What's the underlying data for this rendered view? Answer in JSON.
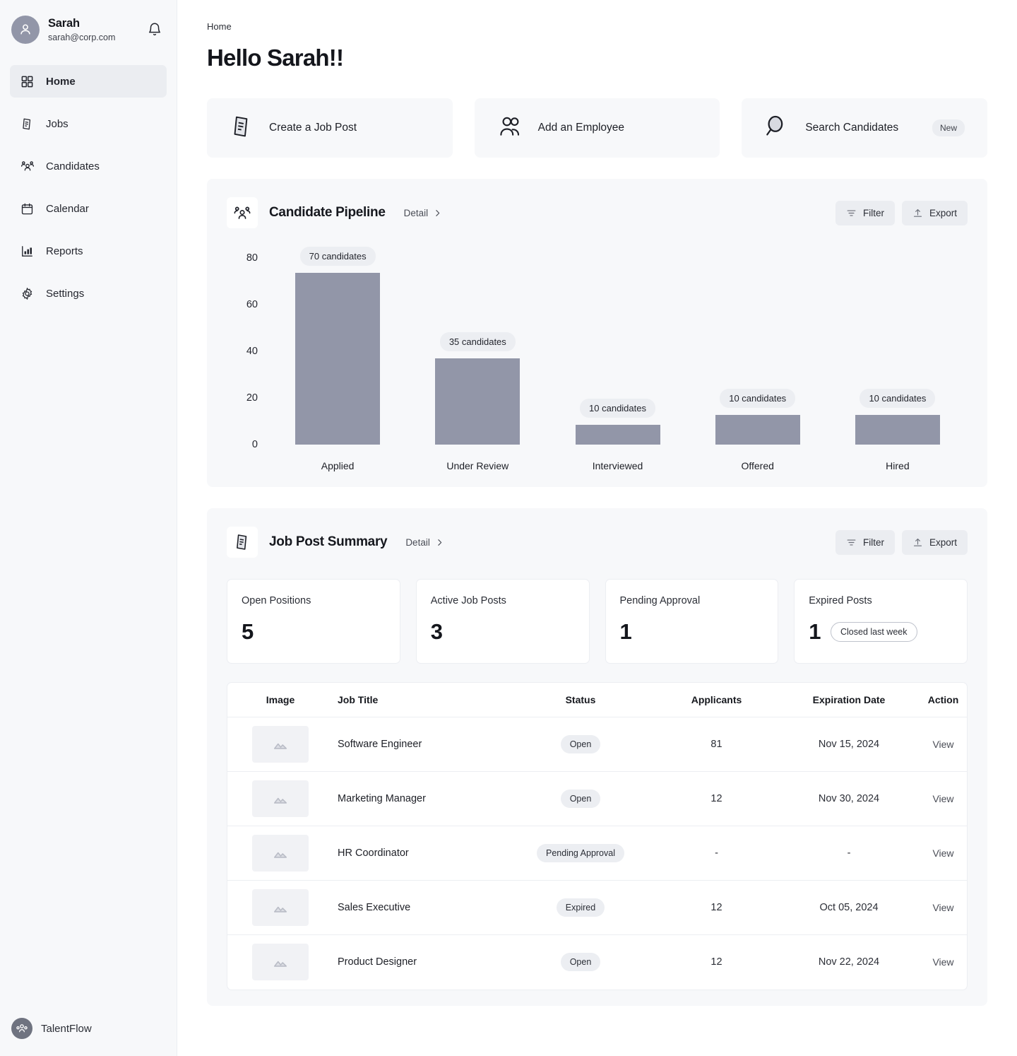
{
  "sidebar": {
    "user": {
      "name": "Sarah",
      "email": "sarah@corp.com",
      "avatar_icon": "person-icon",
      "bell_icon": "bell-icon"
    },
    "items": [
      {
        "label": "Home",
        "icon": "grid-icon",
        "active": true
      },
      {
        "label": "Jobs",
        "icon": "document-icon",
        "active": false
      },
      {
        "label": "Candidates",
        "icon": "people-icon",
        "active": false
      },
      {
        "label": "Calendar",
        "icon": "calendar-icon",
        "active": false
      },
      {
        "label": "Reports",
        "icon": "bar-chart-icon",
        "active": false
      },
      {
        "label": "Settings",
        "icon": "gear-icon",
        "active": false
      }
    ],
    "brand": {
      "name": "TalentFlow",
      "icon": "talentflow-logo-icon"
    }
  },
  "header": {
    "breadcrumb": "Home",
    "title": "Hello Sarah!!"
  },
  "quick_actions": [
    {
      "label": "Create a Job Post",
      "icon": "document-icon",
      "badge": ""
    },
    {
      "label": "Add an Employee",
      "icon": "people-icon",
      "badge": ""
    },
    {
      "label": "Search Candidates",
      "icon": "search-icon",
      "badge": "New"
    }
  ],
  "pipeline": {
    "title": "Candidate Pipeline",
    "icon": "people-icon",
    "detail_label": "Detail",
    "filter_label": "Filter",
    "export_label": "Export"
  },
  "job_summary": {
    "title": "Job Post Summary",
    "icon": "document-icon",
    "detail_label": "Detail",
    "filter_label": "Filter",
    "export_label": "Export",
    "kpis": [
      {
        "label": "Open Positions",
        "value": "5",
        "pill": ""
      },
      {
        "label": "Active Job Posts",
        "value": "3",
        "pill": ""
      },
      {
        "label": "Pending Approval",
        "value": "1",
        "pill": ""
      },
      {
        "label": "Expired Posts",
        "value": "1",
        "pill": "Closed last week"
      }
    ],
    "table": {
      "columns": [
        "Image",
        "Job Title",
        "Status",
        "Applicants",
        "Expiration Date",
        "Action"
      ],
      "action_label": "View",
      "rows": [
        {
          "title": "Software Engineer",
          "status": "Open",
          "applicants": "81",
          "expiration": "Nov 15, 2024",
          "action": "View"
        },
        {
          "title": "Marketing Manager",
          "status": "Open",
          "applicants": "12",
          "expiration": "Nov 30, 2024",
          "action": "View"
        },
        {
          "title": "HR Coordinator",
          "status": "Pending Approval",
          "applicants": "-",
          "expiration": "-",
          "action": "View"
        },
        {
          "title": "Sales Executive",
          "status": "Expired",
          "applicants": "12",
          "expiration": "Oct 05, 2024",
          "action": "View"
        },
        {
          "title": "Product Designer",
          "status": "Open",
          "applicants": "12",
          "expiration": "Nov 22, 2024",
          "action": "View"
        }
      ]
    }
  },
  "colors": {
    "bar": "#9296a8",
    "panel_bg": "#f7f8fa",
    "chip_bg": "#eceef2",
    "text": "#1d1f26"
  },
  "chart_data": {
    "type": "bar",
    "title": "Candidate Pipeline",
    "xlabel": "",
    "ylabel": "",
    "ylim": [
      0,
      80
    ],
    "yticks": [
      80,
      60,
      40,
      20,
      0
    ],
    "grid": false,
    "legend": "none",
    "bar_color": "#9296a8",
    "categories": [
      "Applied",
      "Under Review",
      "Interviewed",
      "Offered",
      "Hired"
    ],
    "values": [
      70,
      35,
      8,
      12,
      12
    ],
    "data_labels": [
      "70 candidates",
      "35 candidates",
      "10 candidates",
      "10 candidates",
      "10 candidates"
    ]
  }
}
